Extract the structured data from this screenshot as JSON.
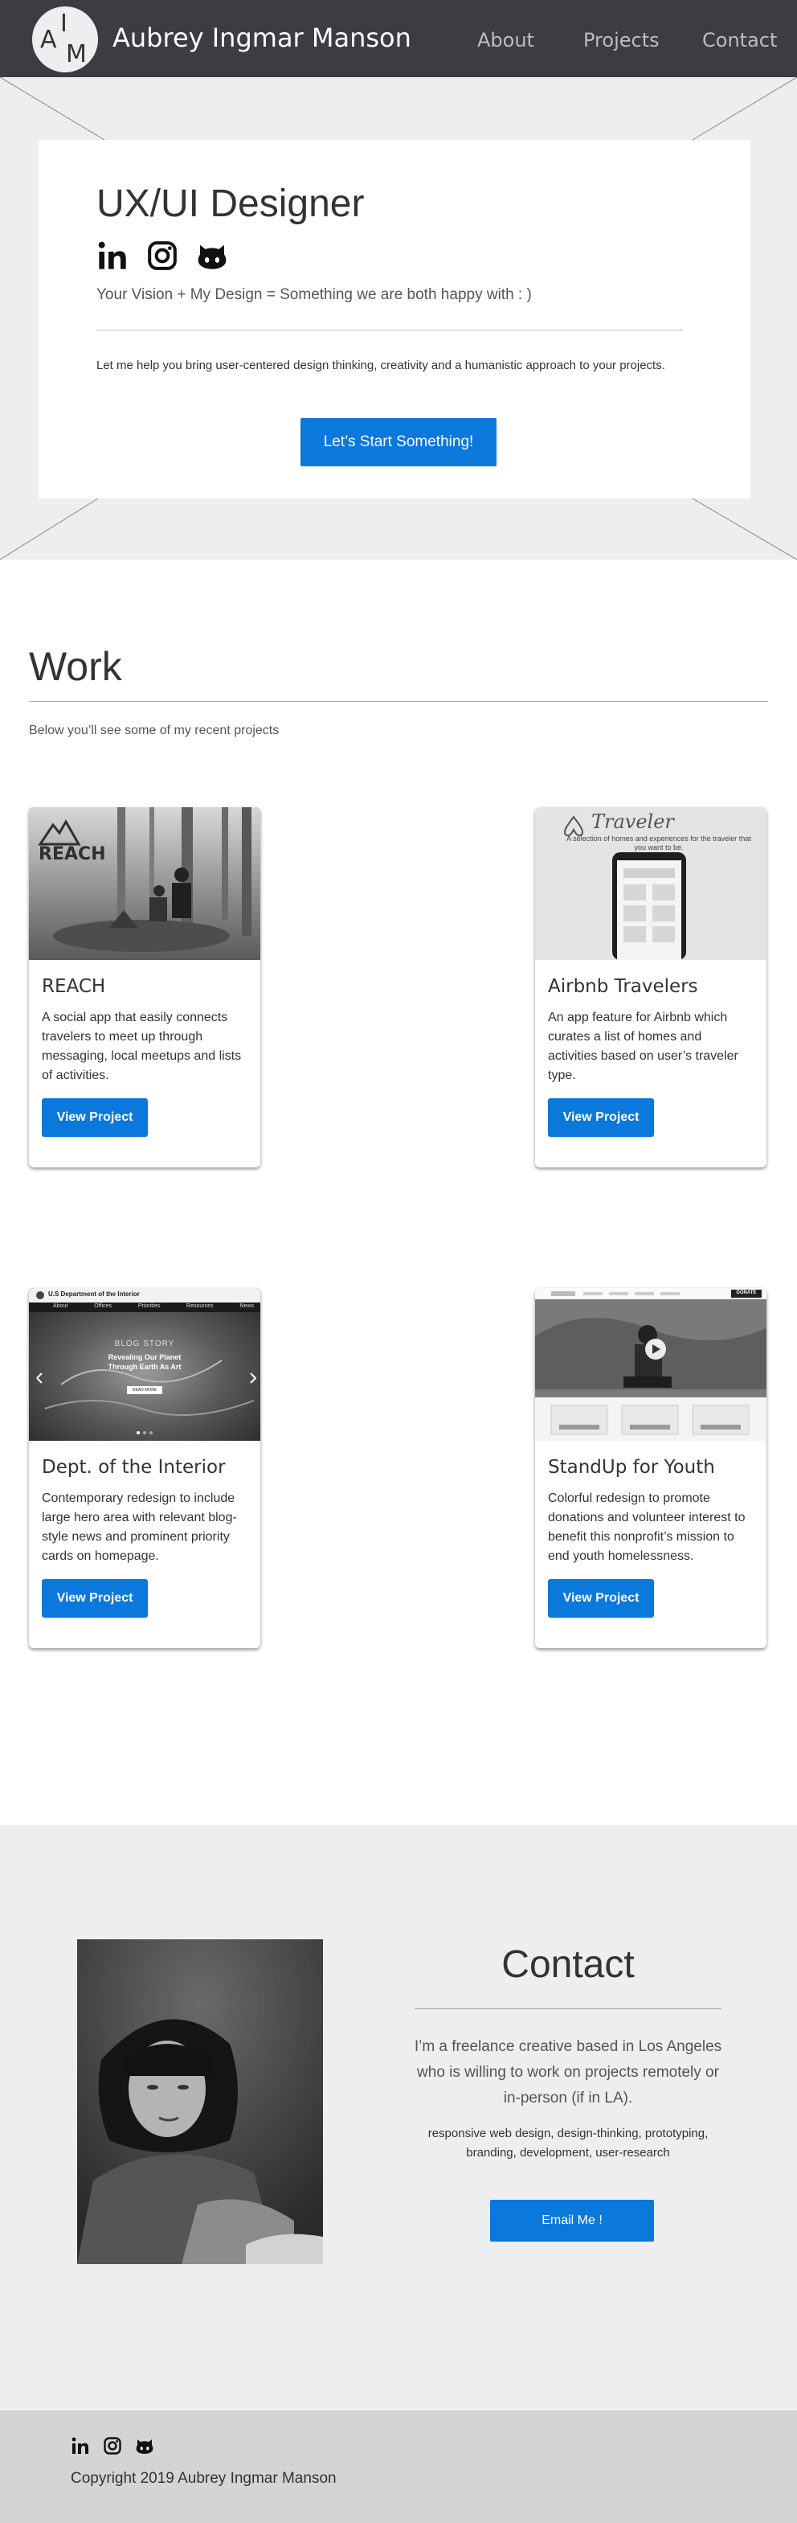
{
  "header": {
    "logo_letters": {
      "left": "A",
      "top": "I",
      "right": "M"
    },
    "site_title": "Aubrey Ingmar Manson",
    "nav": [
      "About",
      "Projects",
      "Contact"
    ]
  },
  "hero": {
    "title": "UX/UI Designer",
    "social_icons": [
      "linkedin-icon",
      "instagram-icon",
      "github-icon"
    ],
    "tagline": "Your Vision +  My Design = Something we are both happy with : )",
    "description": "Let me help you bring user-centered design thinking, creativity and a humanistic approach to your projects.",
    "cta_label": "Let’s Start Something!"
  },
  "work": {
    "title": "Work",
    "subtitle": "Below you’ll see some of my recent projects",
    "projects": [
      {
        "title": "REACH",
        "description": "A social app that easily connects travelers to meet up through messaging, local meetups and lists of activities.",
        "button": "View Project",
        "image_label": "REACH"
      },
      {
        "title": "Airbnb Travelers",
        "description": "An app feature for Airbnb which curates a list of homes and activities based on user’s traveler type.",
        "button": "View Project",
        "image_label": "Traveler",
        "image_caption": "A selection of homes and experiences for the traveler that you want to be."
      },
      {
        "title": "Dept. of the Interior",
        "description": "Contemporary redesign to include large hero area with relevant blog-style news and prominent priority cards on homepage.",
        "button": "View Project",
        "image_label": "U.S Department of the Interior",
        "image_nav": [
          "About",
          "Offices",
          "Priorities",
          "Resources",
          "News"
        ],
        "image_blog_tag": "BLOG STORY",
        "image_headline": "Revealing Our Planet Through Earth As Art",
        "image_cta": "READ MORE"
      },
      {
        "title": "StandUp for Youth",
        "description": "Colorful redesign to promote donations and volunteer interest to benefit this nonprofit’s mission to end youth homelessness.",
        "button": "View Project",
        "image_label": "DONATE"
      }
    ]
  },
  "contact": {
    "title": "Contact",
    "text": "I’m a freelance creative based in Los Angeles who is willing to work on projects remotely or in-person (if in LA).",
    "skills": "responsive web design, design-thinking, prototyping, branding, development, user-research",
    "button": "Email Me !"
  },
  "footer": {
    "social_icons": [
      "linkedin-icon",
      "instagram-icon",
      "github-icon"
    ],
    "copyright": "Copyright 2019 Aubrey Ingmar Manson"
  },
  "colors": {
    "nav_bg": "#3b3d40",
    "accent_button": "#0b78dc",
    "section_bg": "#eceef0",
    "footer_bg": "#d4d4d4"
  }
}
